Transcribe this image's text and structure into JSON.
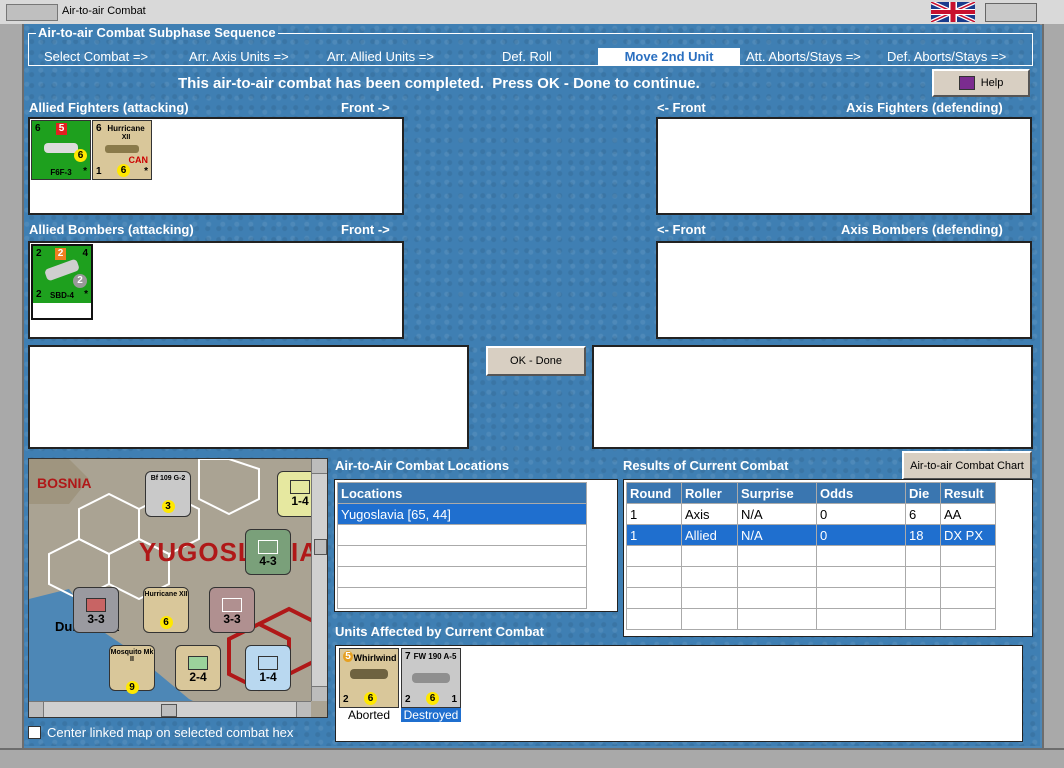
{
  "window": {
    "title": "Air-to-air Combat"
  },
  "sequence": {
    "title": "Air-to-air Combat Subphase Sequence",
    "steps": [
      "Select Combat =>",
      "Arr. Axis Units =>",
      "Arr. Allied Units =>",
      "Def. Roll",
      "Move 2nd Unit",
      "Att. Aborts/Stays =>",
      "Def. Aborts/Stays =>"
    ],
    "active_step": "Move 2nd Unit"
  },
  "status_message": "This air-to-air combat has been completed.  Press OK - Done to continue.",
  "help_label": "Help",
  "ok_done_label": "OK - Done",
  "panels": {
    "allied_fighters": "Allied Fighters (attacking)",
    "axis_fighters": "Axis Fighters (defending)",
    "allied_bombers": "Allied Bombers (attacking)",
    "axis_bombers": "Axis Bombers (defending)",
    "front_right": "Front ->",
    "front_left": "<- Front"
  },
  "allied_fighter_units": [
    {
      "name": "F6F-3",
      "top": "6",
      "badge": "5",
      "value": "6",
      "corner": "*",
      "bg": "#1ea01e"
    },
    {
      "name": "Hurricane",
      "sub": "XII",
      "nation": "CAN",
      "top": "6",
      "bottom": "1",
      "value": "6",
      "corner": "*",
      "bg": "#d9c79a"
    }
  ],
  "allied_bomber_units": [
    {
      "name": "SBD-4",
      "top": "2",
      "badge": "2",
      "right": "4",
      "bottom": "2",
      "value": "2",
      "corner": "*",
      "bg": "#1ea01e"
    }
  ],
  "map": {
    "labels": [
      "BOSNIA",
      "YUGOSLAVIA",
      "Dubrovnik"
    ],
    "counters": [
      {
        "label": "Bf 109 G-2",
        "top": "6",
        "bottom": "3",
        "value": "3",
        "stack": "2"
      },
      {
        "label": "4-3",
        "type": "xxx",
        "unit": "BUL"
      },
      {
        "label": "1-4",
        "type": "xx"
      },
      {
        "label": "3-3",
        "type": "xxx",
        "stack": "3"
      },
      {
        "label": "Hurricane XII",
        "top": "6",
        "bottom": "1",
        "value": "6",
        "stack": "4"
      },
      {
        "label": "3-3",
        "type": "xxx",
        "stack": "2"
      },
      {
        "label": "Mosquito Mk II",
        "top": "6",
        "value": "9",
        "stack": "6"
      },
      {
        "label": "2-4",
        "type": "xx",
        "stack": "2"
      },
      {
        "label": "1-4",
        "type": "xx",
        "stack": "2"
      }
    ]
  },
  "center_map_checkbox": {
    "label": "Center linked map on selected combat hex",
    "checked": false
  },
  "locations": {
    "title": "Air-to-Air Combat Locations",
    "header": "Locations",
    "rows": [
      "Yugoslavia [65, 44]"
    ]
  },
  "results": {
    "title": "Results of Current Combat",
    "chart_button": "Air-to-air Combat Chart",
    "columns": [
      "Round",
      "Roller",
      "Surprise",
      "Odds",
      "Die",
      "Result"
    ],
    "rows": [
      [
        "1",
        "Axis",
        "N/A",
        "0",
        "6",
        "AA"
      ],
      [
        "1",
        "Allied",
        "N/A",
        "0",
        "18",
        "DX PX"
      ]
    ]
  },
  "affected": {
    "title": "Units Affected by Current Combat",
    "units": [
      {
        "name": "Whirlwind",
        "top": "5",
        "bottom": "2",
        "value": "6",
        "status": "Aborted"
      },
      {
        "name": "FW 190 A-5",
        "top": "7",
        "bottom": "2",
        "value": "6",
        "right": "1",
        "status": "Destroyed"
      }
    ]
  }
}
